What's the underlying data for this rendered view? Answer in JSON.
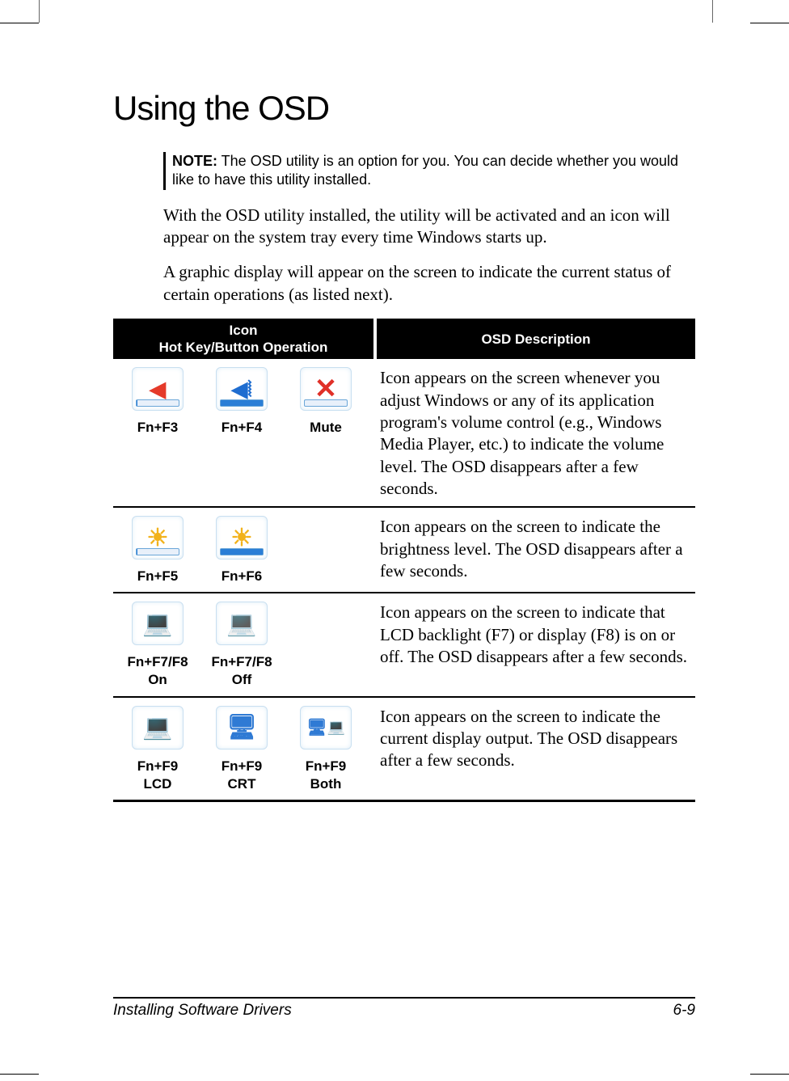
{
  "heading": "Using the OSD",
  "note": {
    "label": "NOTE:",
    "text": " The OSD utility is an option for you. You can decide whether you would like to have this utility installed."
  },
  "paragraphs": [
    "With the OSD utility installed, the utility will be activated and an icon will appear on the system tray every time Windows starts up.",
    "A graphic display will appear on the screen to indicate the current status of certain operations (as listed next)."
  ],
  "table": {
    "head_left_line1": "Icon",
    "head_left_line2": "Hot Key/Button Operation",
    "head_right": "OSD Description",
    "rows": [
      {
        "icons": [
          {
            "key": "Fn+F3",
            "type": "speaker-low",
            "pct": "0%"
          },
          {
            "key": "Fn+F4",
            "type": "speaker-high",
            "pct": "100%"
          },
          {
            "key": "Mute",
            "type": "mute",
            "pct": ""
          }
        ],
        "desc": "Icon appears on the screen whenever you adjust Windows or any of its application program's volume control (e.g., Windows Media Player, etc.) to indicate the volume level. The OSD disappears after a few seconds."
      },
      {
        "icons": [
          {
            "key": "Fn+F5",
            "type": "brightness-low",
            "pct": "0%"
          },
          {
            "key": "Fn+F6",
            "type": "brightness-high",
            "pct": "100%"
          }
        ],
        "desc": "Icon appears on the screen to indicate the brightness level. The OSD disappears after a few seconds."
      },
      {
        "icons": [
          {
            "key": "Fn+F7/F8",
            "key2": "On",
            "type": "laptop-open"
          },
          {
            "key": "Fn+F7/F8",
            "key2": "Off",
            "type": "laptop-closed"
          }
        ],
        "desc": "Icon appears on the screen to indicate that LCD backlight (F7) or display (F8) is on or off. The OSD disappears after a few seconds."
      },
      {
        "icons": [
          {
            "key": "Fn+F9",
            "key2": "LCD",
            "type": "lcd"
          },
          {
            "key": "Fn+F9",
            "key2": "CRT",
            "type": "crt"
          },
          {
            "key": "Fn+F9",
            "key2": "Both",
            "type": "both"
          }
        ],
        "desc": "Icon appears on the screen to indicate the current display output. The OSD disappears after a few seconds."
      }
    ]
  },
  "footer": {
    "left": "Installing Software Drivers",
    "right": "6-9"
  }
}
